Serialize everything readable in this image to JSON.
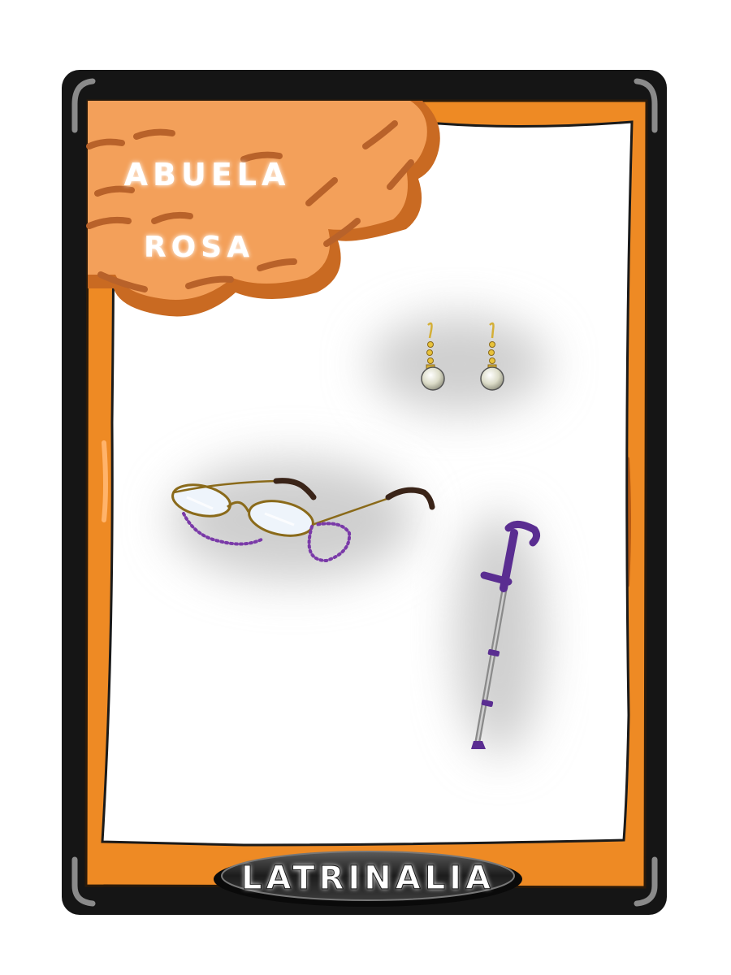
{
  "card": {
    "title_line1": "ABUELA",
    "title_line2": "ROSA",
    "brand": "LATRINALIA",
    "items": [
      {
        "name": "earrings",
        "icon": "pearl-earrings-icon"
      },
      {
        "name": "glasses",
        "icon": "reading-glasses-icon"
      },
      {
        "name": "crutch",
        "icon": "forearm-crutch-icon"
      }
    ]
  },
  "colors": {
    "frame_black": "#151515",
    "frame_orange": "#ee8a24",
    "cloud_orange": "#f3a05a",
    "cloud_stroke": "#c0682a",
    "accessory_purple": "#5a2d91",
    "gold": "#d4af37"
  }
}
